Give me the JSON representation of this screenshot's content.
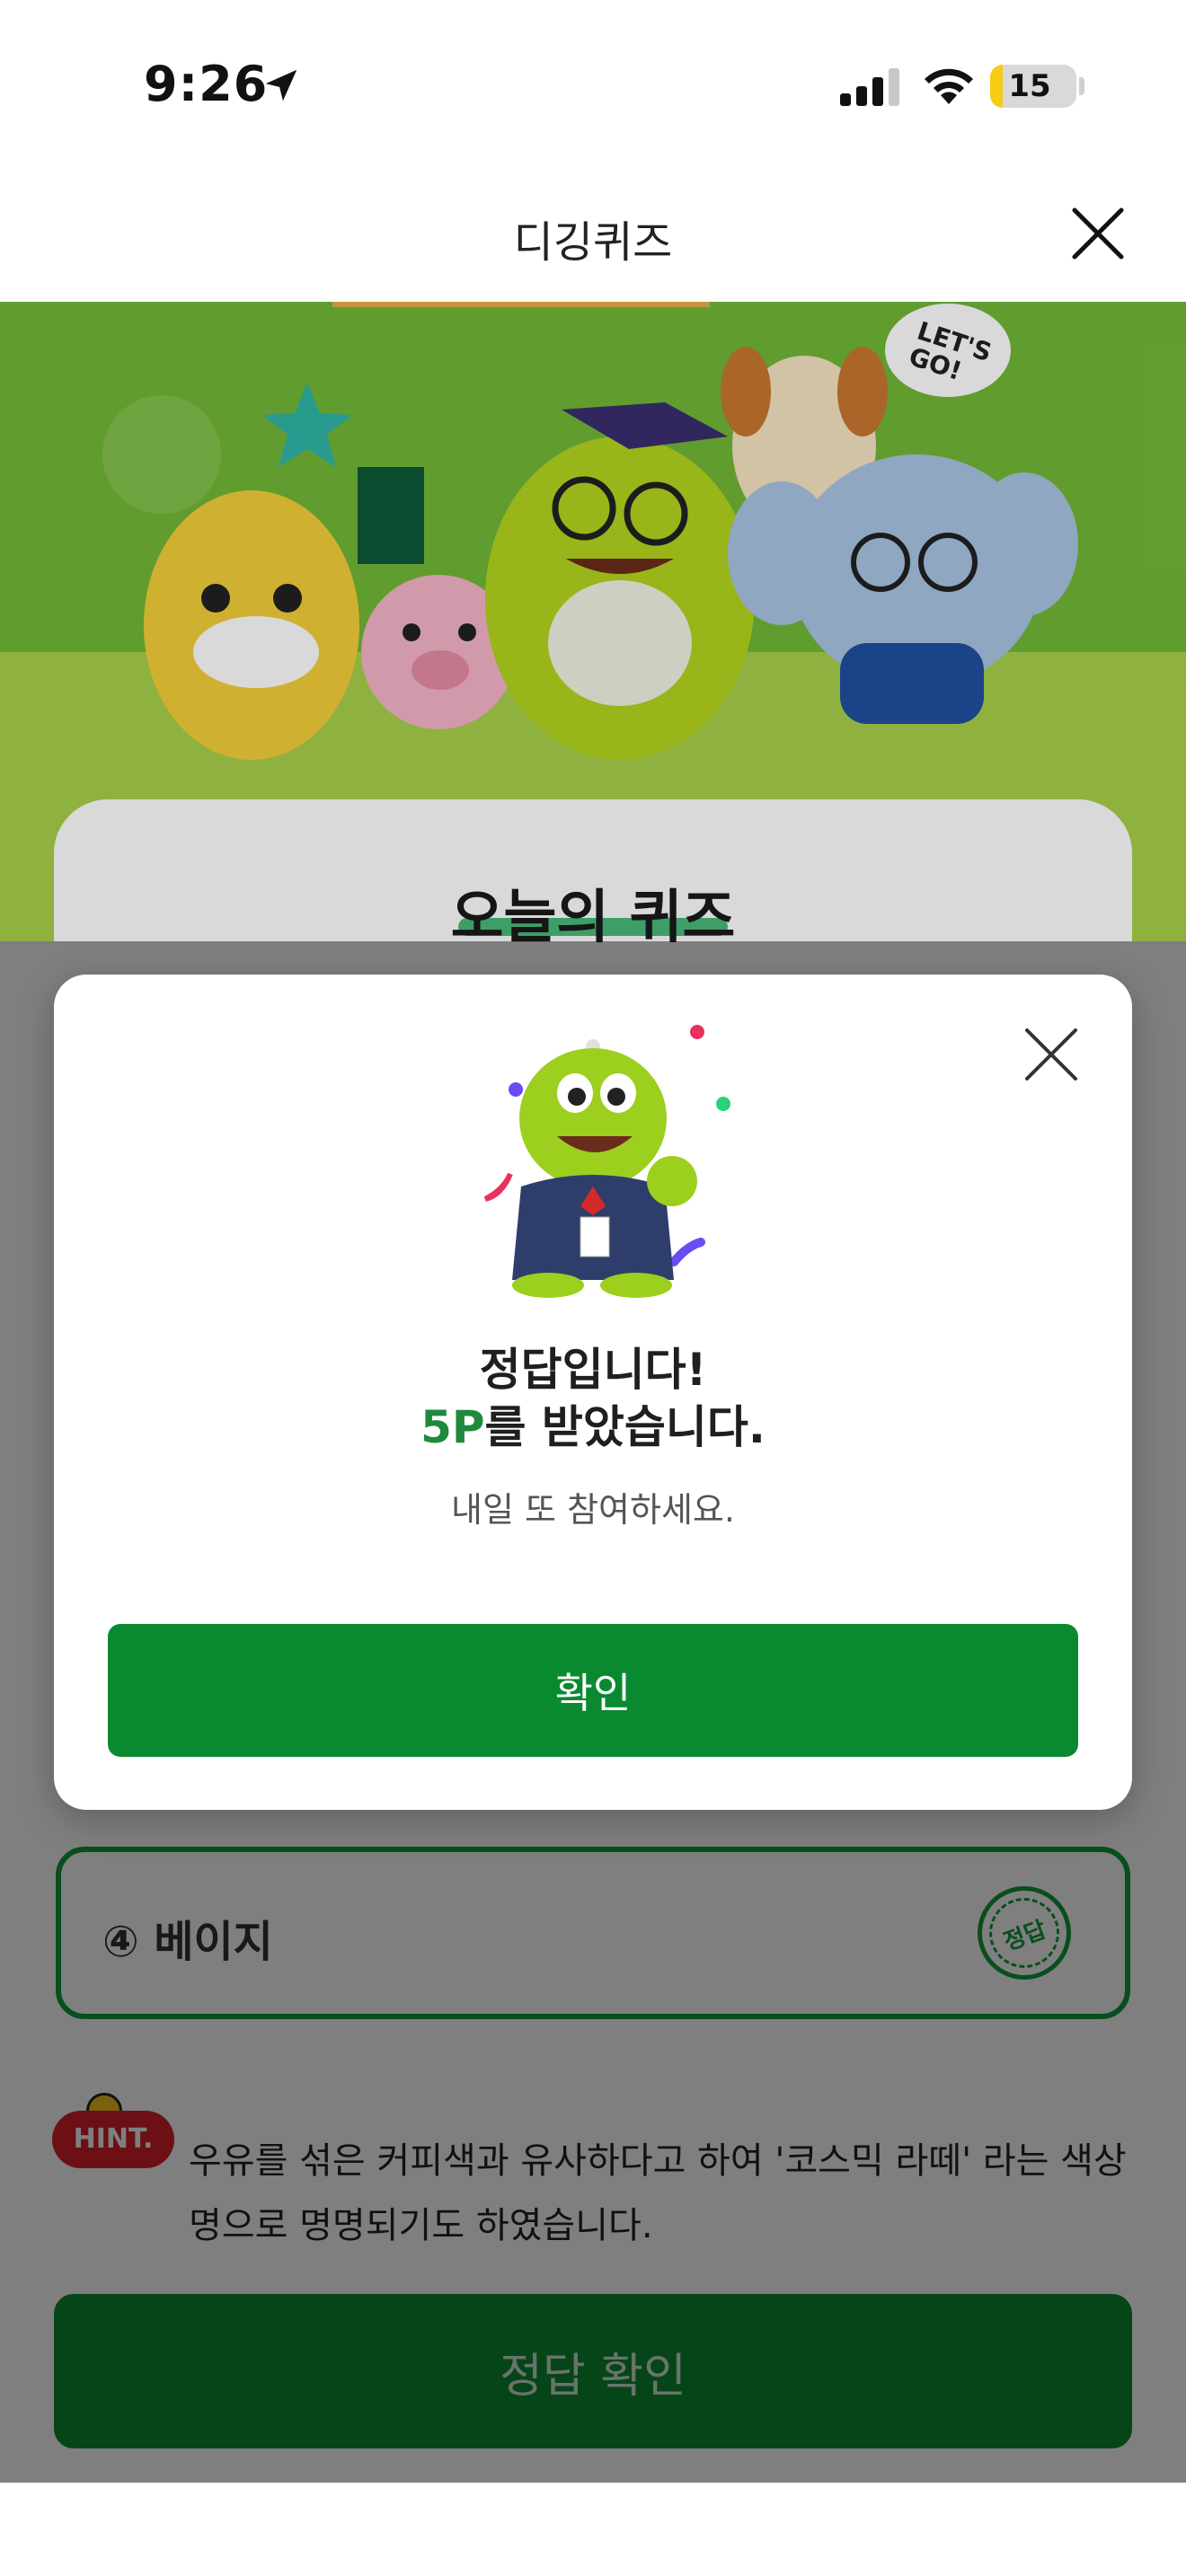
{
  "status_bar": {
    "time": "9:26",
    "battery": "15",
    "battery_level": 0.15
  },
  "nav": {
    "title": "디깅퀴즈"
  },
  "hero": {
    "speech_bubble": "LET'S GO!"
  },
  "quiz": {
    "title": "오늘의 퀴즈",
    "option4_label": "④ 베이지",
    "answer_stamp": "정답",
    "hint_badge": "HINT.",
    "hint_text": "우유를 섞은 커피색과 유사하다고 하여 '코스믹 라떼' 라는 색상명으로 명명되기도 하였습니다.",
    "check_answer_button": "정답 확인"
  },
  "modal": {
    "title_line1": "정답입니다!",
    "points": "5P",
    "title_line2_rest": "를 받았습니다.",
    "subtitle": "내일 또 참여하세요.",
    "confirm_button": "확인"
  },
  "colors": {
    "primary_green": "#0a8a30",
    "hint_red": "#d8202a",
    "hero_green": "#73b838"
  }
}
